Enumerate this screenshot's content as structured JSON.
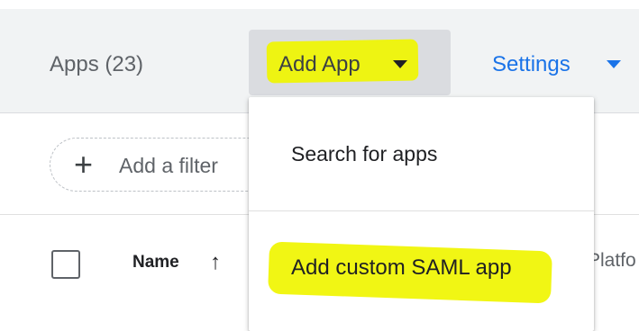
{
  "header": {
    "apps_count_label": "Apps (23)",
    "add_app_label": "Add App",
    "settings_label": "Settings"
  },
  "filter": {
    "label": "Add a filter"
  },
  "table": {
    "name_header": "Name",
    "platform_header": "Platfo"
  },
  "dropdown": {
    "items": [
      {
        "label": "Search for apps"
      },
      {
        "label": "Add custom SAML app"
      }
    ]
  },
  "colors": {
    "highlight": "#f0f500",
    "accent": "#1a73e8",
    "header_background": "#f1f3f4"
  },
  "icons": [
    "caret-down-icon",
    "plus-icon",
    "sort-arrow-up-icon",
    "checkbox-icon"
  ]
}
